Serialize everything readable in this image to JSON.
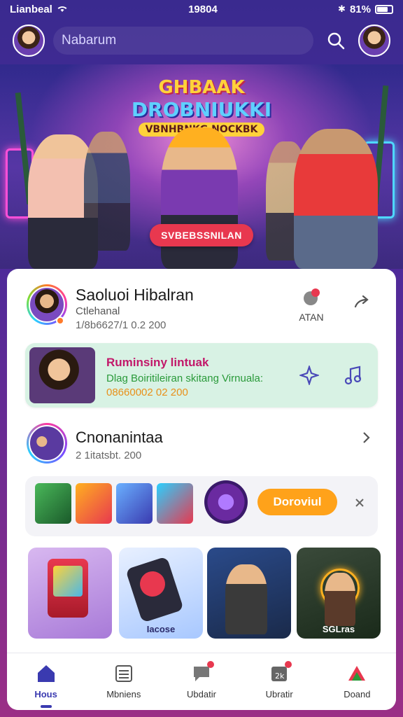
{
  "status_bar": {
    "carrier": "Lianbeal",
    "time": "19804",
    "battery": "81%"
  },
  "top_bar": {
    "search_placeholder": "Nabarum"
  },
  "banner": {
    "title_line1": "GHBAAK",
    "title_line2": "DROBNIUKKI",
    "title_line3": "VBNHBNKG NOCKBK",
    "cta_label": "SVBEBSSNILAN"
  },
  "card": {
    "profile": {
      "name": "Saoluoi Hibalran",
      "subtitle": "Ctlehanal",
      "meta": "1/8b6627/1 0.2 200",
      "action_label": "ATAN"
    },
    "highlight": {
      "title": "Ruminsiny lintuak",
      "subtitle": "Dlag Boiritileiran skitang Virnuala:",
      "meta": "08660002 02 200"
    },
    "channel": {
      "name": "Cnonanintaa",
      "meta": "2 1itatsbt. 200"
    },
    "download_label": "Doroviul",
    "tiles": [
      {
        "label": ""
      },
      {
        "label": "Iacose"
      },
      {
        "label": ""
      },
      {
        "label": "SGLras"
      }
    ]
  },
  "bottom_nav": [
    {
      "label": "Hous",
      "icon": "home-icon",
      "active": true
    },
    {
      "label": "Mbniens",
      "icon": "list-icon",
      "active": false
    },
    {
      "label": "Ubdatir",
      "icon": "chat-icon",
      "active": false
    },
    {
      "label": "Ubratir",
      "icon": "calendar-icon",
      "active": false
    },
    {
      "label": "Doand",
      "icon": "triangle-icon",
      "active": false
    }
  ],
  "colors": {
    "accent": "#3a3ab0",
    "cta": "#e8384f",
    "download": "#ffa21a",
    "highlight_bg": "#d8f2e4"
  }
}
